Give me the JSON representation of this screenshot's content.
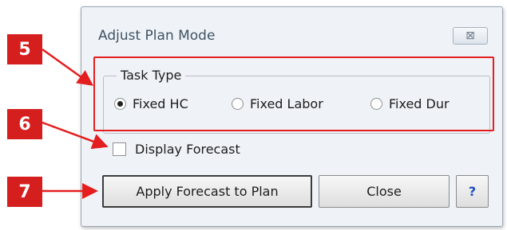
{
  "dialog": {
    "title": "Adjust Plan Mode",
    "close_glyph": "⊠",
    "task_type": {
      "legend": "Task Type",
      "options": [
        {
          "label": "Fixed HC",
          "selected": true
        },
        {
          "label": "Fixed Labor",
          "selected": false
        },
        {
          "label": "Fixed Dur",
          "selected": false
        }
      ]
    },
    "display_forecast": {
      "label": "Display Forecast",
      "checked": false
    },
    "buttons": {
      "apply": "Apply Forecast to Plan",
      "close": "Close",
      "help": "?"
    }
  },
  "callouts": [
    {
      "number": "5"
    },
    {
      "number": "6"
    },
    {
      "number": "7"
    }
  ],
  "colors": {
    "callout_red": "#d51f1f",
    "highlight_red": "#e41e1e",
    "dialog_bg": "#eff3f8",
    "help_blue": "#1d4fbf"
  }
}
